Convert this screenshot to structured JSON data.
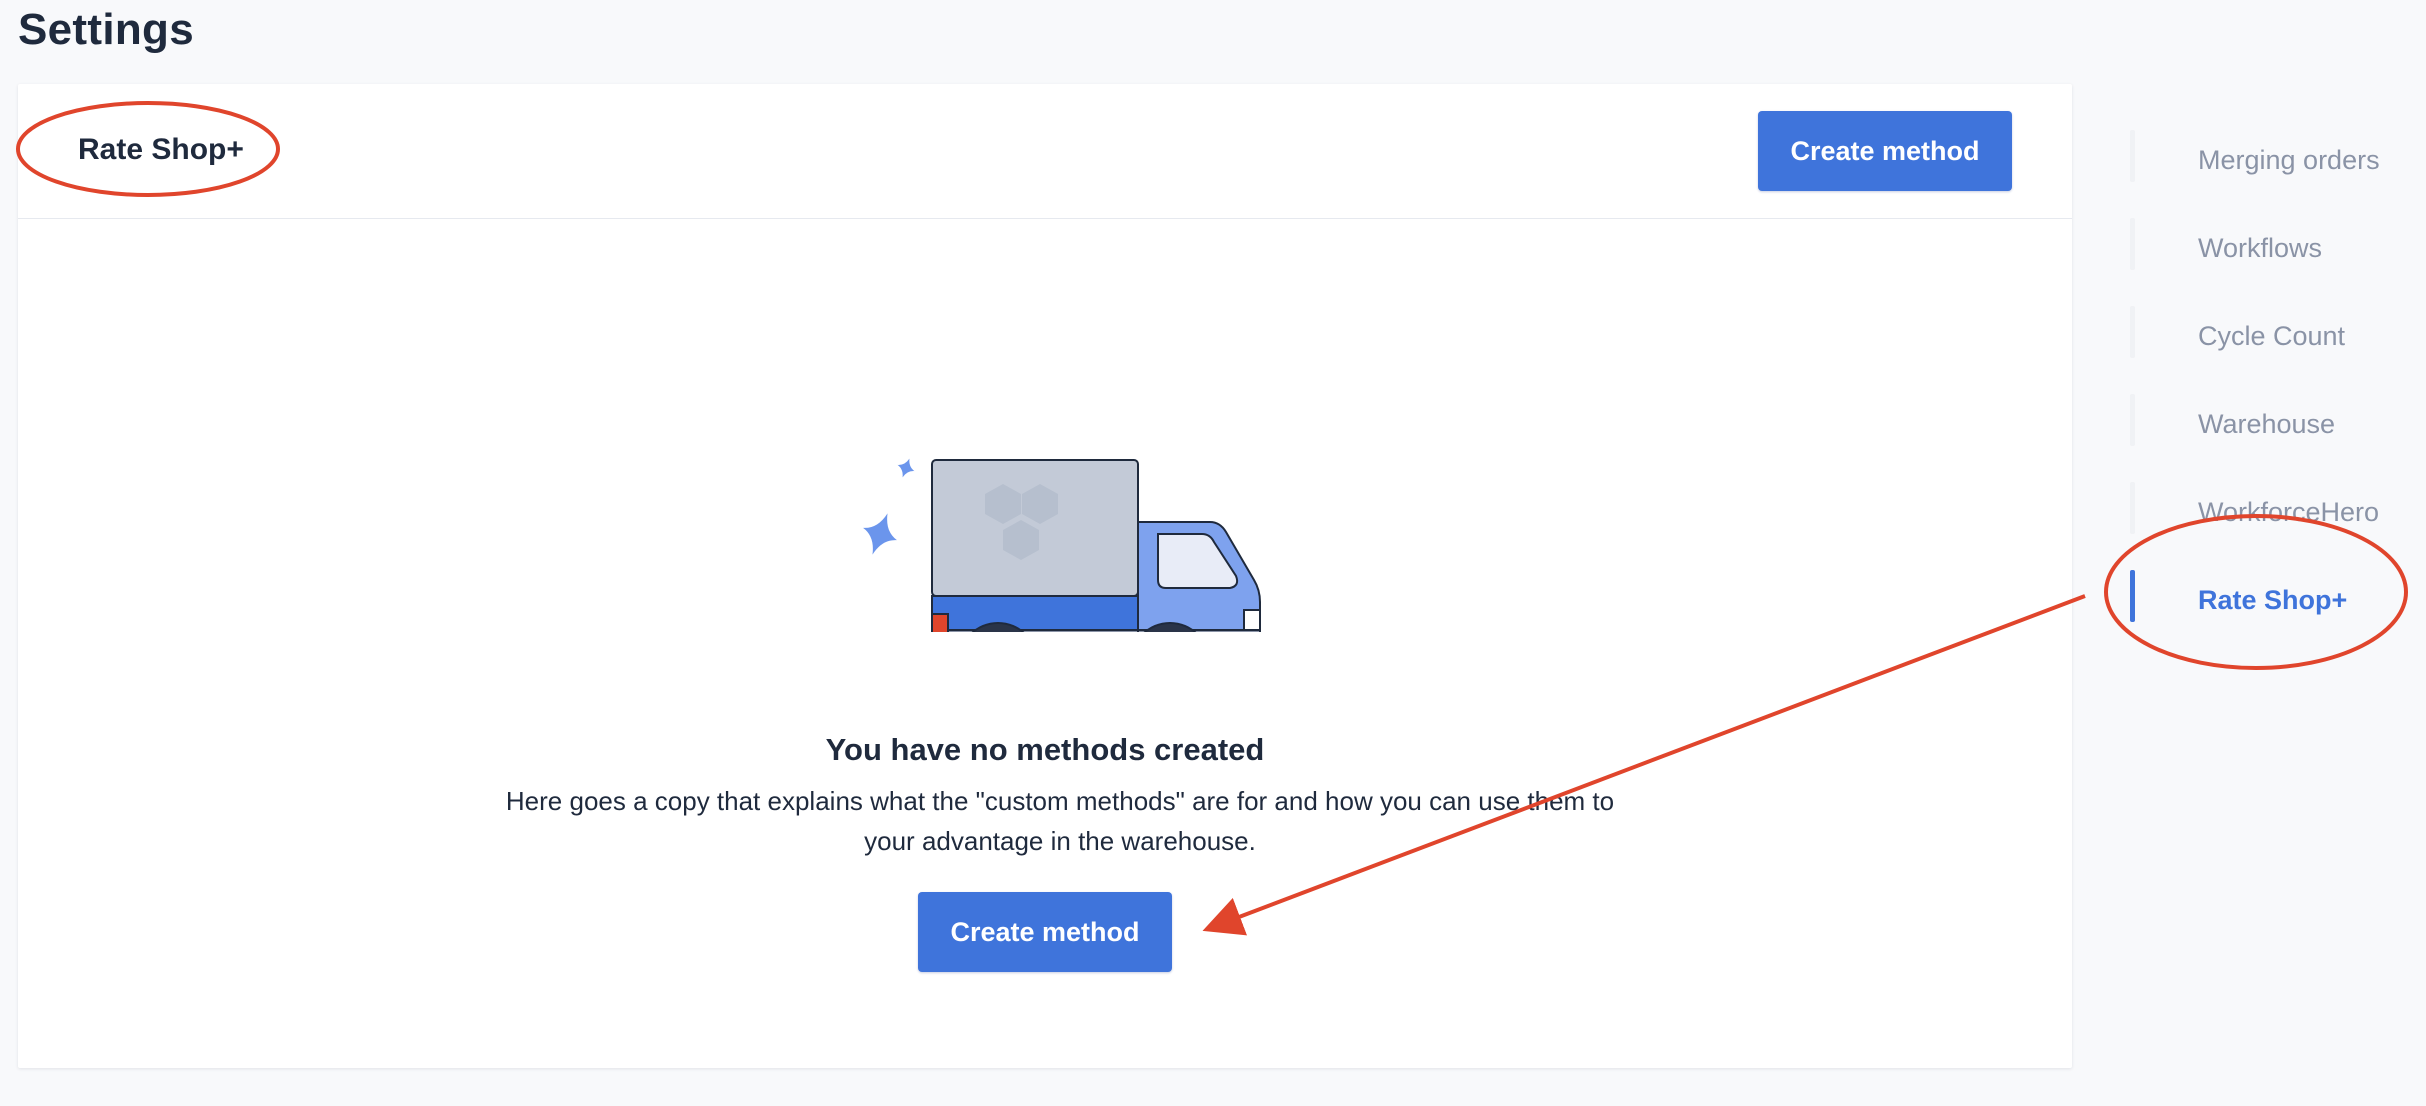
{
  "page": {
    "title": "Settings"
  },
  "card": {
    "title": "Rate Shop+",
    "header_button_label": "Create method",
    "empty_state": {
      "title": "You have no methods created",
      "description": "Here goes a copy that explains what the \"custom methods\" are for and how you can use them to your advantage in the warehouse.",
      "button_label": "Create method",
      "illustration": "truck-illustration"
    }
  },
  "sidebar": {
    "items": [
      {
        "label": "Merging orders",
        "active": false
      },
      {
        "label": "Workflows",
        "active": false
      },
      {
        "label": "Cycle Count",
        "active": false
      },
      {
        "label": "Warehouse",
        "active": false
      },
      {
        "label": "WorkforceHero",
        "active": false
      },
      {
        "label": "Rate Shop+",
        "active": true
      }
    ]
  },
  "colors": {
    "accent": "#3f74db",
    "annotation": "#e0452c",
    "background": "#f8f9fb",
    "text": "#1f2a3d",
    "muted": "#8a93a6"
  },
  "annotations": {
    "items": [
      "red-ellipse-card-title",
      "red-ellipse-sidebar-rate-shop",
      "red-arrow-to-create-button"
    ]
  }
}
